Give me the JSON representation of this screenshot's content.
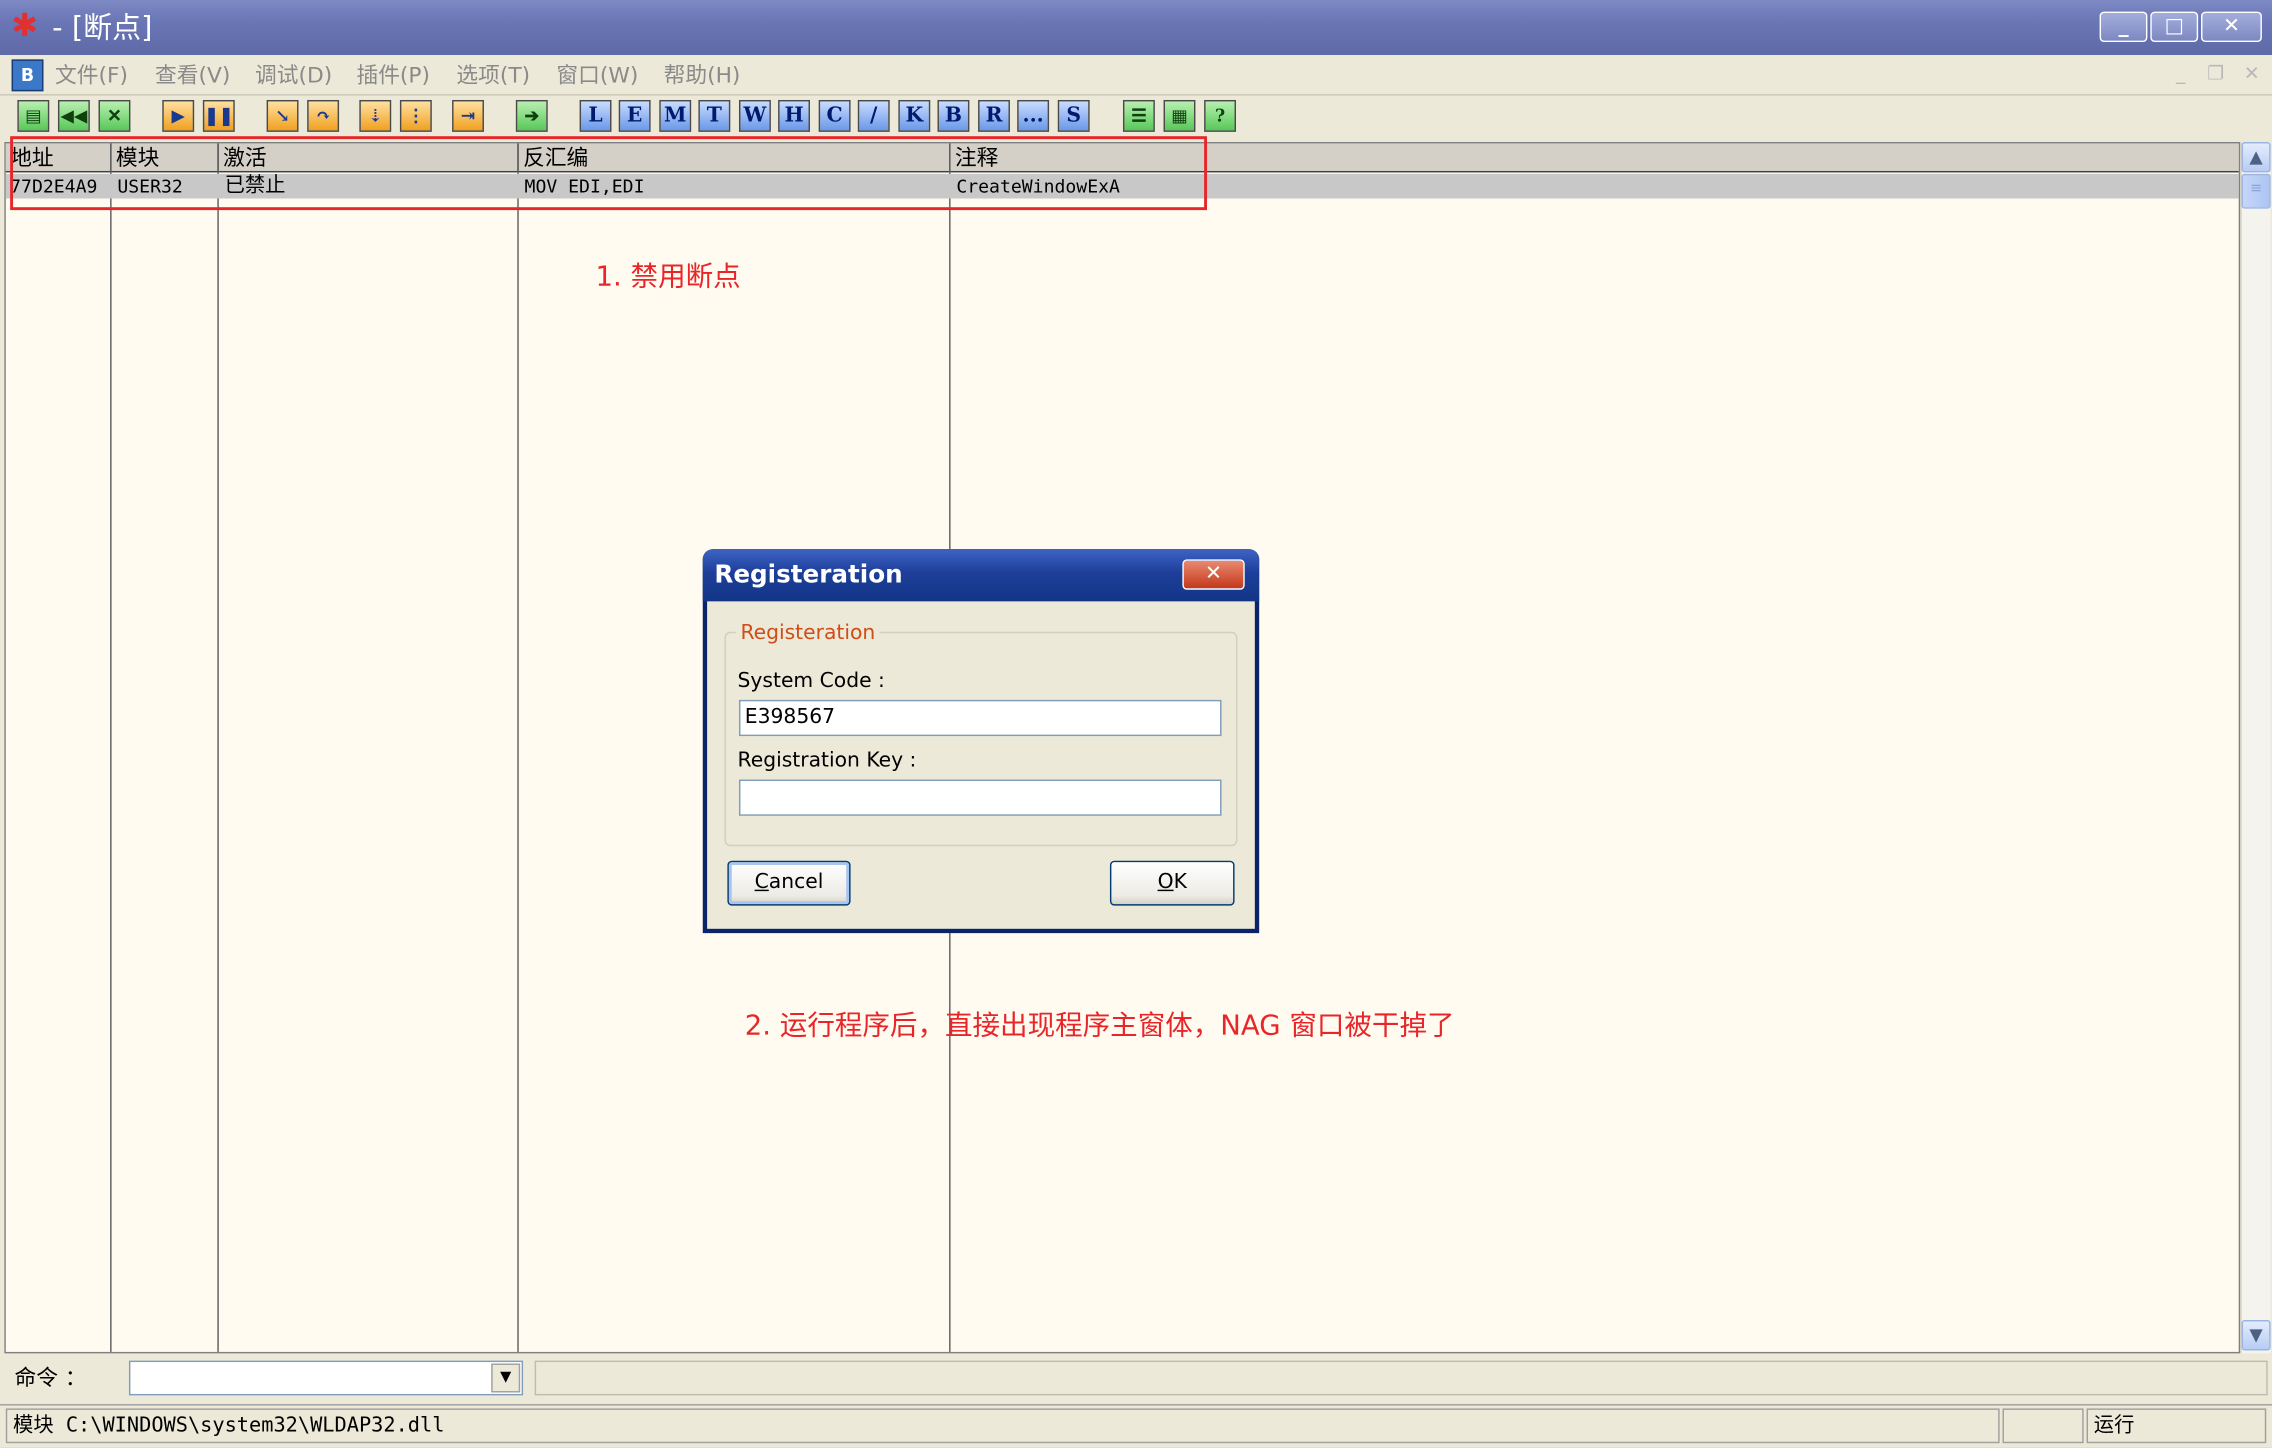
{
  "window": {
    "title": "- [断点]",
    "minimize": "_",
    "maximize": "□",
    "close": "✕"
  },
  "menu": {
    "logo": "B",
    "items": [
      "文件(F)",
      "查看(V)",
      "调试(D)",
      "插件(P)",
      "选项(T)",
      "窗口(W)",
      "帮助(H)"
    ]
  },
  "toolbar": {
    "letters": [
      "L",
      "E",
      "M",
      "T",
      "W",
      "H",
      "C",
      "/",
      "K",
      "B",
      "R",
      "...",
      "S"
    ]
  },
  "breakpoints": {
    "columns": [
      "地址",
      "模块",
      "激活",
      "反汇编",
      "注释"
    ],
    "rows": [
      {
        "address": "77D2E4A9",
        "module": "USER32",
        "active": "已禁止",
        "disasm": "MOV EDI,EDI",
        "comment": "CreateWindowExA"
      }
    ]
  },
  "annotations": {
    "note1": "1. 禁用断点",
    "note2": "2. 运行程序后，直接出现程序主窗体，NAG 窗口被干掉了"
  },
  "dialog": {
    "title": "Registeration",
    "group_label": "Registeration",
    "system_code_label": "System Code :",
    "system_code_value": "E398567",
    "registration_key_label": "Registration Key :",
    "registration_key_value": "",
    "cancel_first": "C",
    "cancel_rest": "ancel",
    "ok_first": "O",
    "ok_rest": "K"
  },
  "command": {
    "label": "命令 ：",
    "value": ""
  },
  "status": {
    "module_path": "模块 C:\\WINDOWS\\system32\\WLDAP32.dll",
    "state": "运行"
  },
  "colors": {
    "annotation": "#e8262a",
    "dialog_title": "#1d3f9a"
  }
}
